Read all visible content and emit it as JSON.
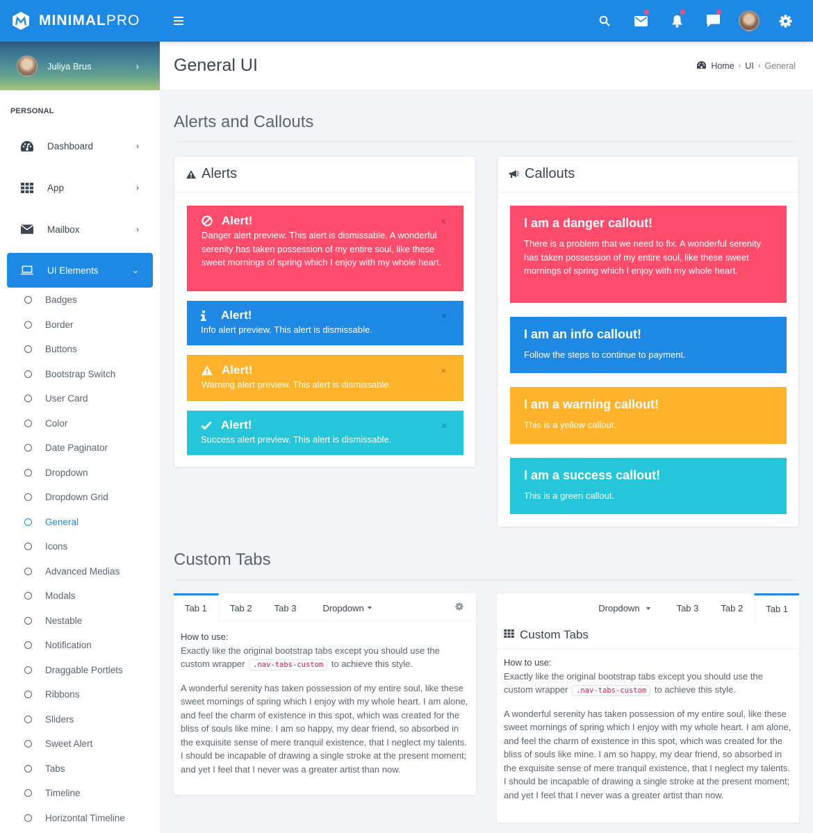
{
  "brand": {
    "bold": "MINIMAL",
    "light": "PRO"
  },
  "header_icons": [
    {
      "name": "search-icon",
      "badge": false
    },
    {
      "name": "mail-icon",
      "badge": true
    },
    {
      "name": "bell-icon",
      "badge": true
    },
    {
      "name": "chat-icon",
      "badge": true
    },
    {
      "name": "user-avatar",
      "badge": false
    },
    {
      "name": "gear-icon",
      "badge": false
    }
  ],
  "user": {
    "name": "Juliya Brus"
  },
  "sidebar": {
    "section_label": "PERSONAL",
    "items": [
      {
        "label": "Dashboard",
        "icon": "dashboard-icon"
      },
      {
        "label": "App",
        "icon": "grid-icon"
      },
      {
        "label": "Mailbox",
        "icon": "envelope-icon"
      },
      {
        "label": "UI Elements",
        "icon": "laptop-icon",
        "active": true
      }
    ],
    "sub_items": [
      "Badges",
      "Border",
      "Buttons",
      "Bootstrap Switch",
      "User Card",
      "Color",
      "Date Paginator",
      "Dropdown",
      "Dropdown Grid",
      "General",
      "Icons",
      "Advanced Medias",
      "Modals",
      "Nestable",
      "Notification",
      "Draggable Portlets",
      "Ribbons",
      "Sliders",
      "Sweet Alert",
      "Tabs",
      "Timeline",
      "Horizontal Timeline"
    ],
    "current_sub": "General"
  },
  "page": {
    "title": "General UI",
    "breadcrumb": [
      "Home",
      "UI",
      "General"
    ]
  },
  "sections": {
    "alerts_callouts": "Alerts and Callouts",
    "custom_tabs": "Custom Tabs"
  },
  "alerts": {
    "title": "Alerts",
    "items": [
      {
        "type": "danger",
        "icon": "ban-icon",
        "title": "Alert!",
        "text": "Danger alert preview. This alert is dismissable. A wonderful serenity has taken possession of my entire soul, like these sweet mornings of spring which I enjoy with my whole heart.",
        "close": "×"
      },
      {
        "type": "info",
        "icon": "info-icon",
        "title": "Alert!",
        "text": "Info alert preview. This alert is dismissable.",
        "close": "×"
      },
      {
        "type": "warning",
        "icon": "warning-icon",
        "title": "Alert!",
        "text": "Warning alert preview. This alert is dismissable.",
        "close": "×"
      },
      {
        "type": "success",
        "icon": "check-icon",
        "title": "Alert!",
        "text": "Success alert preview. This alert is dismissable.",
        "close": "×"
      }
    ]
  },
  "callouts": {
    "title": "Callouts",
    "items": [
      {
        "type": "danger",
        "title": "I am a danger callout!",
        "text": "There is a problem that we need to fix. A wonderful serenity has taken possession of my entire soul, like these sweet mornings of spring which I enjoy with my whole heart."
      },
      {
        "type": "info",
        "title": "I am an info callout!",
        "text": "Follow the steps to continue to payment."
      },
      {
        "type": "warning",
        "title": "I am a warning callout!",
        "text": "This is a yellow callout."
      },
      {
        "type": "success",
        "title": "I am a success callout!",
        "text": "This is a green callout."
      }
    ]
  },
  "tabs_left": {
    "tabs": [
      "Tab 1",
      "Tab 2",
      "Tab 3",
      "Dropdown"
    ],
    "active": "Tab 1"
  },
  "tabs_right": {
    "tabs": [
      "Dropdown",
      "Tab 3",
      "Tab 2",
      "Tab 1"
    ],
    "active": "Tab 1",
    "title": "Custom Tabs"
  },
  "tab_content": {
    "how_label": "How to use:",
    "how_before": "Exactly like the original bootstrap tabs except you should use the custom wrapper",
    "code": ".nav-tabs-custom",
    "how_after": "to achieve this style.",
    "paragraph": "A wonderful serenity has taken possession of my entire soul, like these sweet mornings of spring which I enjoy with my whole heart. I am alone, and feel the charm of existence in this spot, which was created for the bliss of souls like mine. I am so happy, my dear friend, so absorbed in the exquisite sense of mere tranquil existence, that I neglect my talents. I should be incapable of drawing a single stroke at the present moment; and yet I feel that I never was a greater artist than now."
  },
  "colors": {
    "primary": "#1e88e5",
    "danger": "#ff4c6d",
    "warning": "#ffb22b",
    "success": "#26c6da"
  }
}
